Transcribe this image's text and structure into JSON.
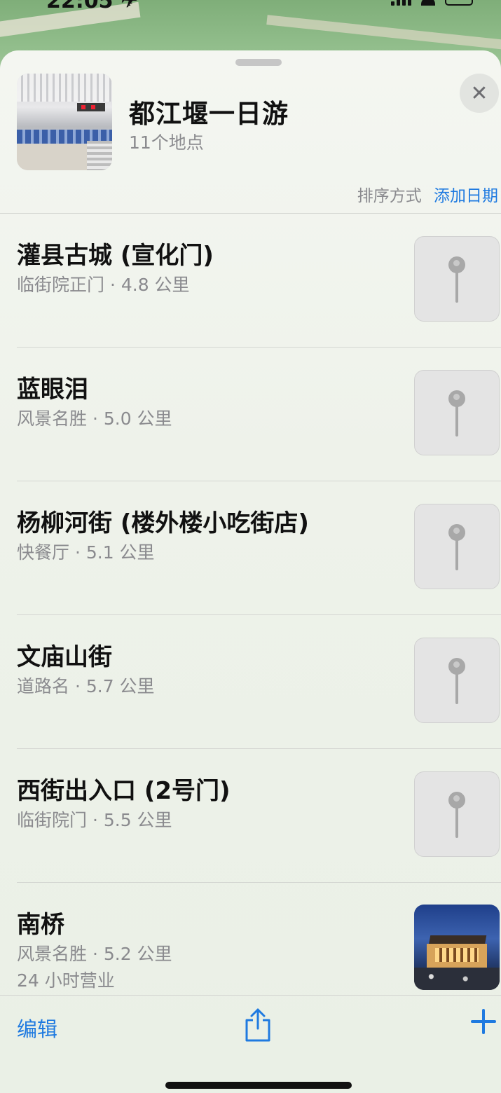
{
  "status_bar": {
    "time": "22:05 ✈"
  },
  "guide": {
    "title": "都江堰一日游",
    "count": "11个地点",
    "sort_label": "排序方式",
    "add_date_label": "添加日期"
  },
  "places": [
    {
      "name": "灌县古城 (宣化门)",
      "meta": "临街院正门 · 4.8 公里",
      "thumbnail_icon": "map-pin-icon"
    },
    {
      "name": "蓝眼泪",
      "meta": "风景名胜 · 5.0 公里",
      "thumbnail_icon": "map-pin-icon"
    },
    {
      "name": "杨柳河街 (楼外楼小吃街店)",
      "meta": "快餐厅 · 5.1 公里",
      "thumbnail_icon": "map-pin-icon"
    },
    {
      "name": "文庙山街",
      "meta": "道路名 · 5.7 公里",
      "thumbnail_icon": "map-pin-icon"
    },
    {
      "name": "西街出入口 (2号门)",
      "meta": "临街院门 · 5.5 公里",
      "thumbnail_icon": "map-pin-icon"
    },
    {
      "name": "南桥",
      "meta": "风景名胜 · 5.2 公里",
      "extra": "24 小时营业",
      "thumbnail_icon": "photo"
    }
  ],
  "toolbar": {
    "edit_label": "编辑",
    "share_icon": "share-icon",
    "add_icon": "plus-icon"
  },
  "colors": {
    "accent": "#1f7ae0",
    "secondary_text": "#8a8a8e",
    "pin_tile": "#e4e4e4"
  }
}
